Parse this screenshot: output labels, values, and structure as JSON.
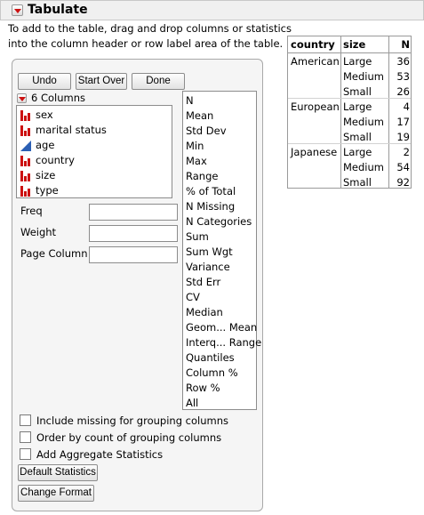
{
  "header": {
    "title": "Tabulate"
  },
  "instructions": [
    "To add to the table, drag and drop columns or statistics",
    "into the column header or row label area of the table."
  ],
  "buttons": {
    "undo": "Undo",
    "start_over": "Start Over",
    "done": "Done"
  },
  "columns_panel": {
    "title": "6 Columns",
    "items": [
      {
        "label": "sex",
        "modeling_type": "nominal-icon"
      },
      {
        "label": "marital status",
        "modeling_type": "nominal-icon"
      },
      {
        "label": "age",
        "modeling_type": "continuous-icon"
      },
      {
        "label": "country",
        "modeling_type": "nominal-icon"
      },
      {
        "label": "size",
        "modeling_type": "nominal-icon"
      },
      {
        "label": "type",
        "modeling_type": "nominal-icon"
      }
    ]
  },
  "statistics": [
    "N",
    "Mean",
    "Std Dev",
    "Min",
    "Max",
    "Range",
    "% of Total",
    "N Missing",
    "N Categories",
    "Sum",
    "Sum Wgt",
    "Variance",
    "Std Err",
    "CV",
    "Median",
    "Geom... Mean",
    "Interq... Range",
    "Quantiles",
    "Column %",
    "Row %",
    "All"
  ],
  "fields": {
    "freq": "Freq",
    "weight": "Weight",
    "page_column": "Page Column"
  },
  "options": {
    "include_missing": "Include missing for grouping columns",
    "order_by_count": "Order by count of grouping columns",
    "add_aggregate": "Add Aggregate Statistics"
  },
  "bottom_buttons": {
    "default_statistics": "Default Statistics",
    "change_format": "Change Format"
  },
  "result_table": {
    "headers": [
      "country",
      "size",
      "N"
    ],
    "groups": [
      {
        "country": "American",
        "rows": [
          {
            "size": "Large",
            "n": "36"
          },
          {
            "size": "Medium",
            "n": "53"
          },
          {
            "size": "Small",
            "n": "26"
          }
        ]
      },
      {
        "country": "European",
        "rows": [
          {
            "size": "Large",
            "n": "4"
          },
          {
            "size": "Medium",
            "n": "17"
          },
          {
            "size": "Small",
            "n": "19"
          }
        ]
      },
      {
        "country": "Japanese",
        "rows": [
          {
            "size": "Large",
            "n": "2"
          },
          {
            "size": "Medium",
            "n": "54"
          },
          {
            "size": "Small",
            "n": "92"
          }
        ]
      }
    ]
  }
}
